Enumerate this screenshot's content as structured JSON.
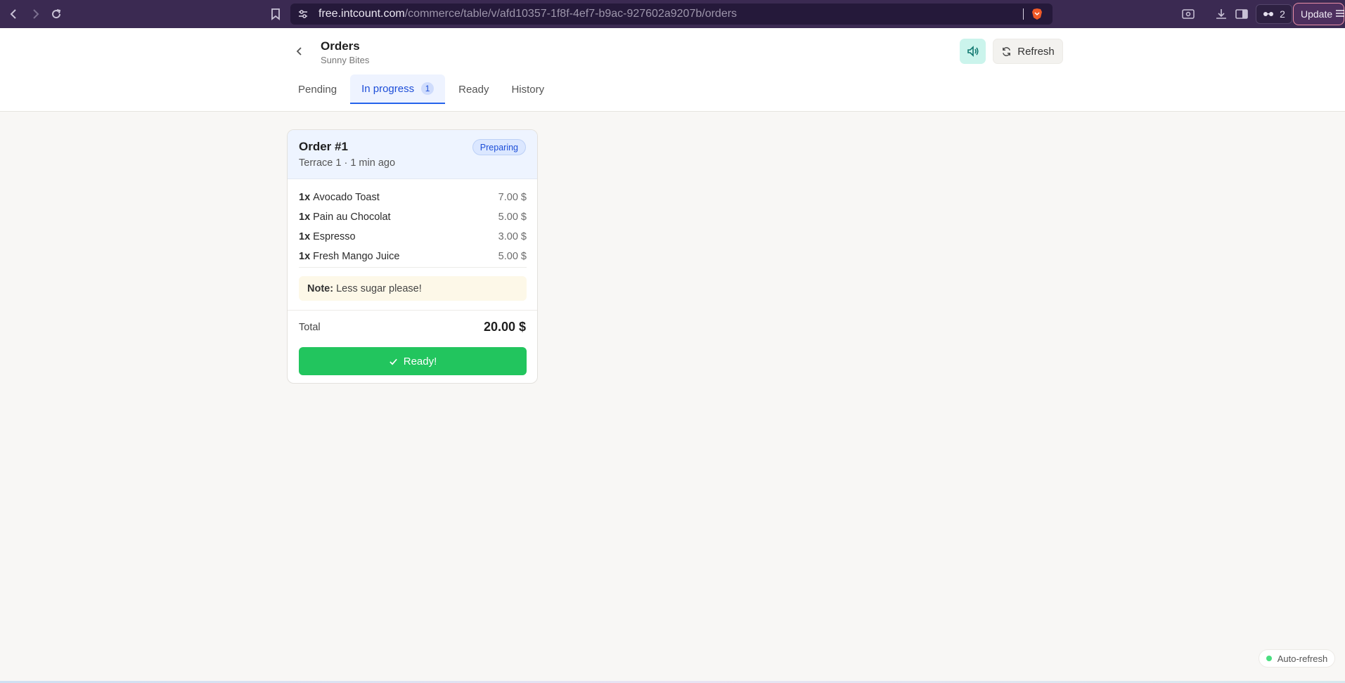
{
  "browser": {
    "url_host": "free.intcount.com",
    "url_path": "/commerce/table/v/afd10357-1f8f-4ef7-b9ac-927602a9207b/orders",
    "ext_count": "2",
    "update_label": "Update"
  },
  "header": {
    "title": "Orders",
    "subtitle": "Sunny Bites",
    "refresh_label": "Refresh",
    "tabs": [
      {
        "label": "Pending"
      },
      {
        "label": "In progress",
        "badge": "1"
      },
      {
        "label": "Ready"
      },
      {
        "label": "History"
      }
    ]
  },
  "order": {
    "title": "Order #1",
    "meta": "Terrace 1 · 1 min ago",
    "status": "Preparing",
    "items": [
      {
        "qty": "1x",
        "name": "Avocado Toast",
        "price": "7.00 $"
      },
      {
        "qty": "1x",
        "name": "Pain au Chocolat",
        "price": "5.00 $"
      },
      {
        "qty": "1x",
        "name": "Espresso",
        "price": "3.00 $"
      },
      {
        "qty": "1x",
        "name": "Fresh Mango Juice",
        "price": "5.00 $"
      }
    ],
    "note_label": "Note:",
    "note_text": "Less sugar please!",
    "total_label": "Total",
    "total_value": "20.00 $",
    "ready_label": "Ready!"
  },
  "auto_refresh_label": "Auto-refresh",
  "colors": {
    "accent": "#2563eb",
    "ready_green": "#22c55e",
    "browser_bg": "#3b2a52"
  }
}
